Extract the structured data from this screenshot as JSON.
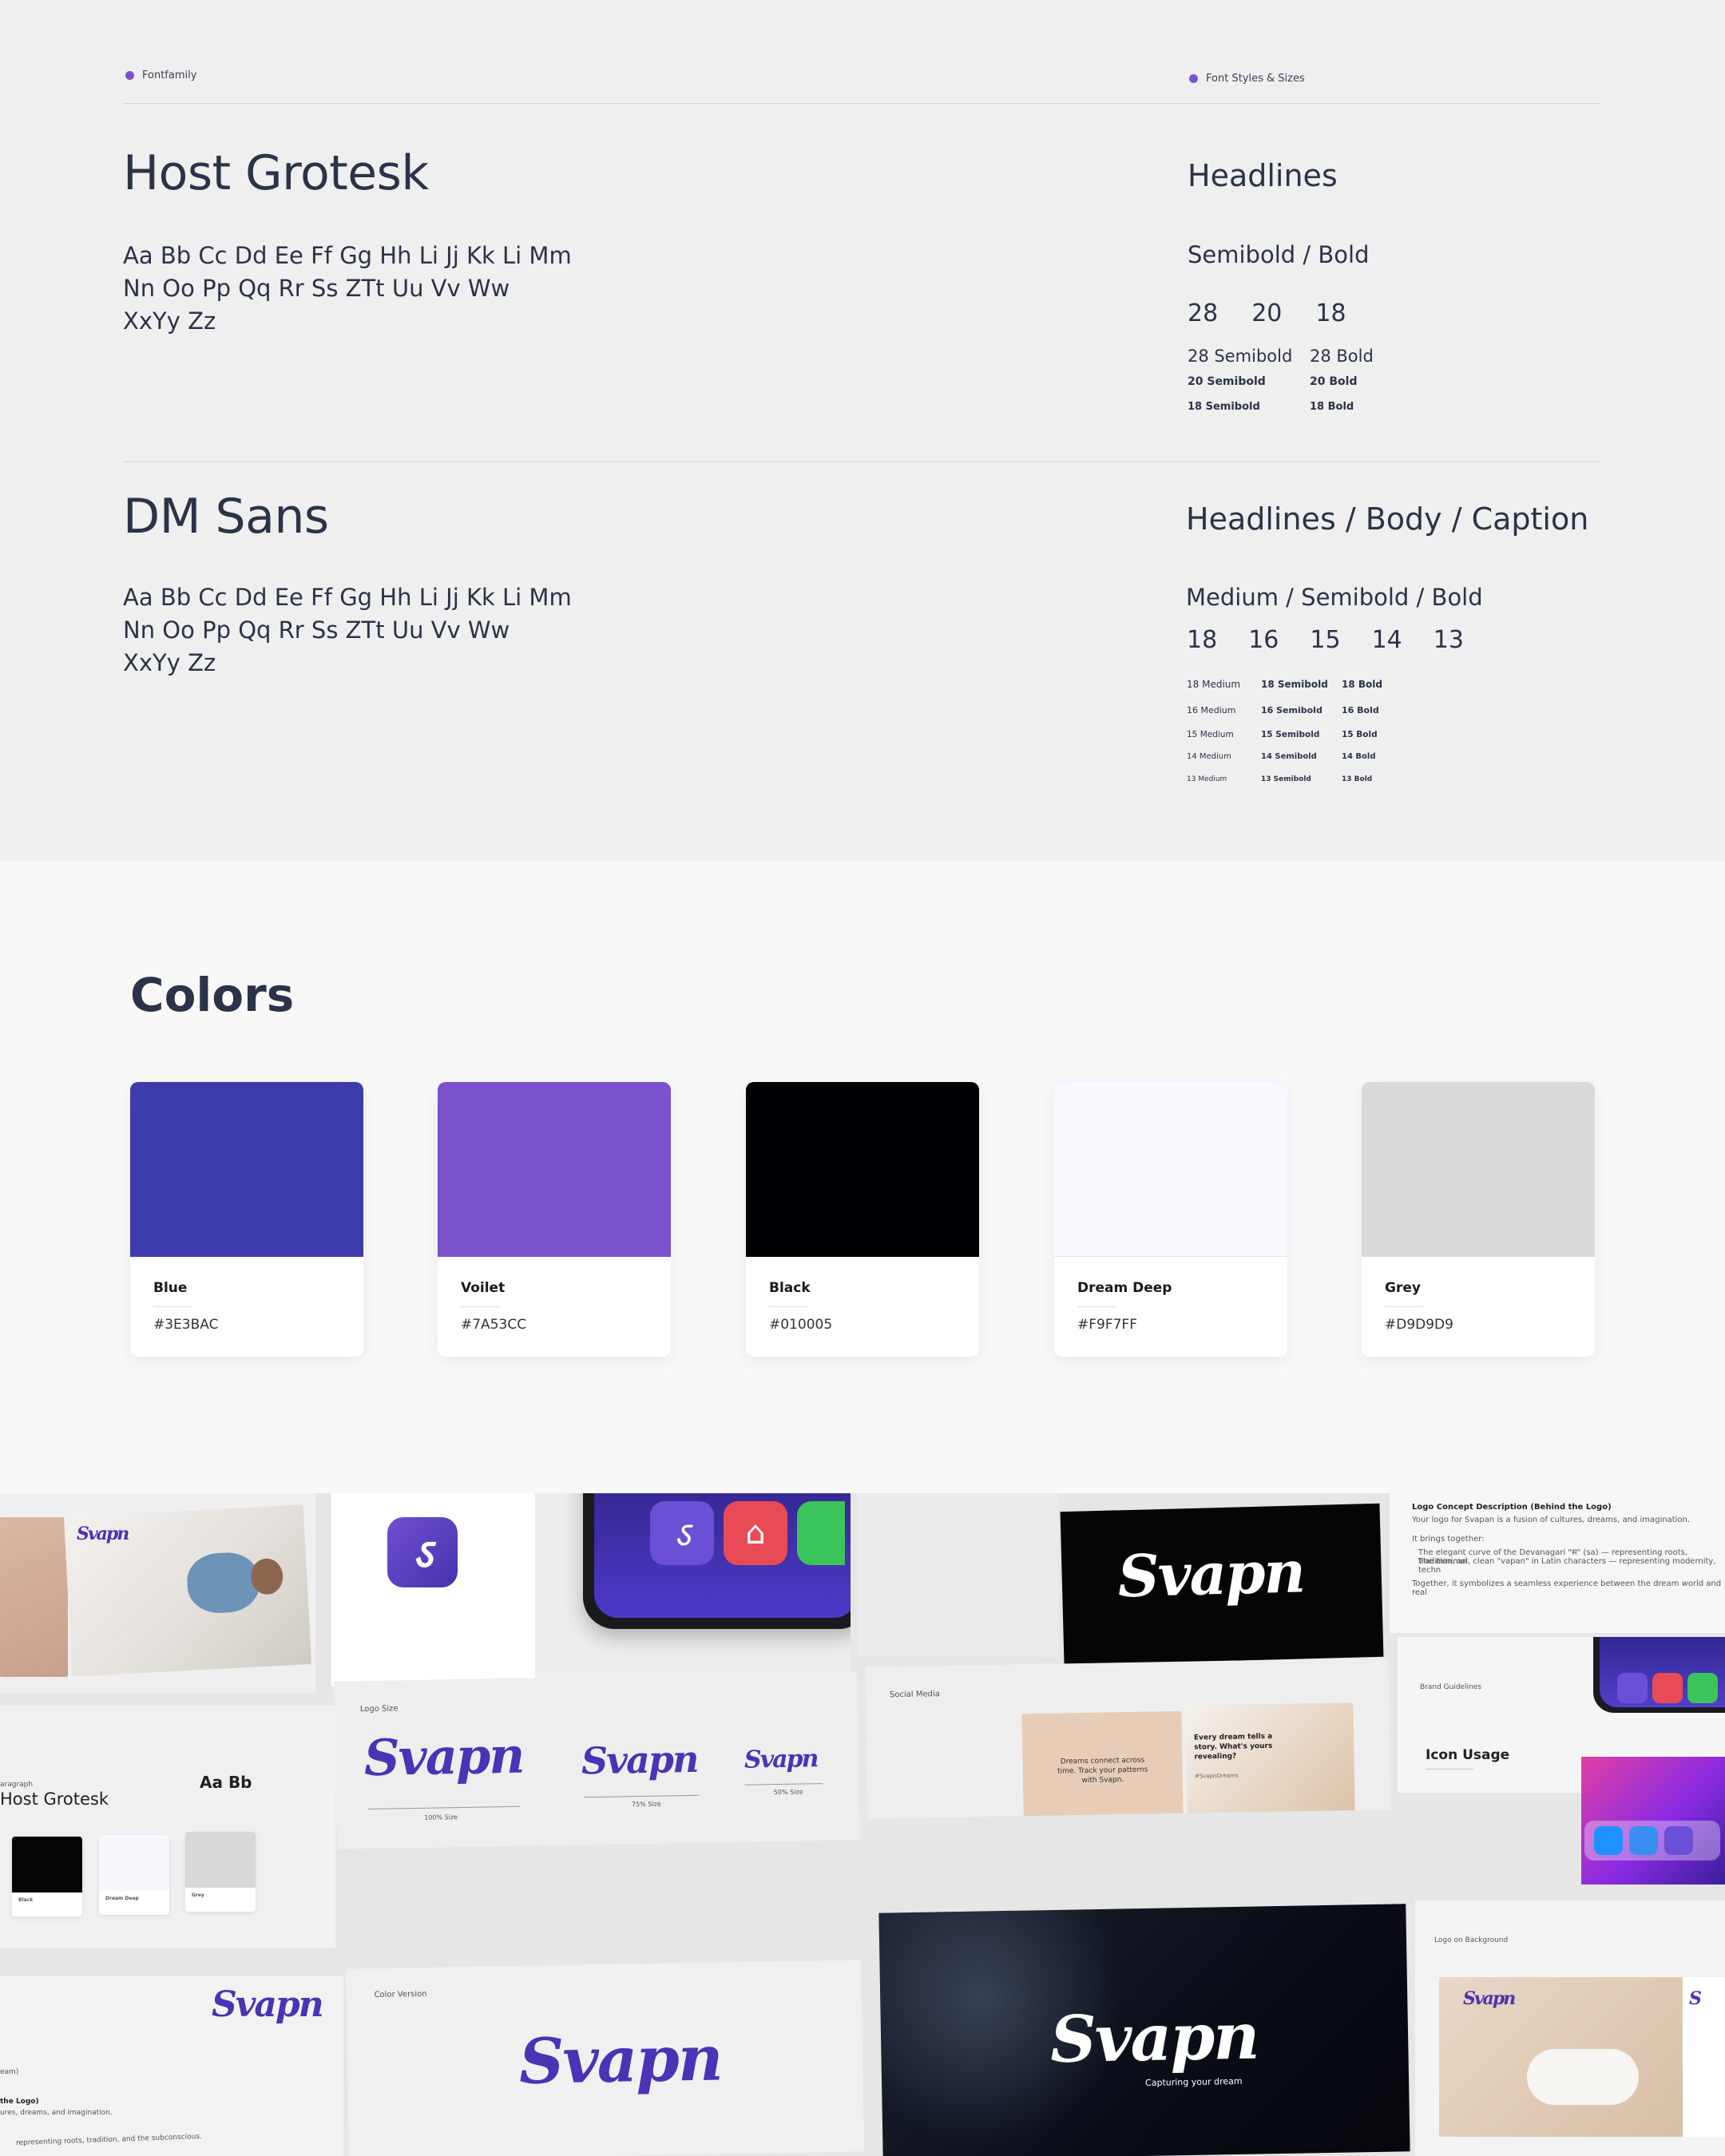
{
  "typography": {
    "tag_left": "Fontfamily",
    "tag_right": "Font Styles & Sizes",
    "host": {
      "name": "Host Grotesk",
      "alphabet": [
        "Aa Bb Cc Dd Ee Ff Gg Hh Li Jj Kk Li Mm",
        "Nn Oo Pp Qq Rr Ss ZTt Uu Vv Ww",
        "XxYy Zz"
      ],
      "title": "Headlines",
      "weights": "Semibold / Bold",
      "sizes": [
        "28",
        "20",
        "18"
      ],
      "table": [
        [
          "28 Semibold",
          "28 Bold"
        ],
        [
          "20 Semibold",
          "20 Bold"
        ],
        [
          "18 Semibold",
          "18 Bold"
        ]
      ]
    },
    "dm": {
      "name": "DM Sans",
      "alphabet": [
        "Aa Bb Cc Dd Ee Ff Gg Hh Li Jj Kk Li Mm",
        "Nn Oo Pp Qq Rr Ss ZTt Uu Vv Ww",
        "XxYy Zz"
      ],
      "title": "Headlines / Body / Caption",
      "weights": "Medium / Semibold / Bold",
      "sizes": [
        "18",
        "16",
        "15",
        "14",
        "13"
      ],
      "table": [
        [
          "18 Medium",
          "18 Semibold",
          "18 Bold"
        ],
        [
          "16 Medium",
          "16 Semibold",
          "16 Bold"
        ],
        [
          "15 Medium",
          "15 Semibold",
          "15 Bold"
        ],
        [
          "14 Medium",
          "14 Semibold",
          "14 Bold"
        ],
        [
          "13 Medium",
          "13 Semibold",
          "13 Bold"
        ]
      ]
    }
  },
  "colors": {
    "title": "Colors",
    "swatches": [
      {
        "name": "Blue",
        "hex": "#3E3BAC",
        "color": "#3E3BAC"
      },
      {
        "name": "Voilet",
        "hex": "#7A53CC",
        "color": "#7A53CC"
      },
      {
        "name": "Black",
        "hex": "#010005",
        "color": "#010005"
      },
      {
        "name": "Dream Deep",
        "hex": "#F9F7FF",
        "color": "#F9F7FF"
      },
      {
        "name": "Grey",
        "hex": "#D9D9D9",
        "color": "#D9D9D9"
      }
    ]
  },
  "collage": {
    "brand": "Svapn",
    "logo_word": "vapn",
    "tagline": "Capturing your dream",
    "labels": {
      "logo_size": "Logo Size",
      "size_100": "100% Size",
      "size_75": "75% Size",
      "size_50": "50% Size",
      "social": "Social Media",
      "brand_guidelines": "Brand Guidelines",
      "icon_usage": "Icon Usage",
      "color_version": "Color Version",
      "logo_on_background": "Logo on Background",
      "logo_concept": "Logo Concept Description (Behind the Logo)",
      "concept_line1": "Your logo for Svapan is a fusion of cultures, dreams, and imagination.",
      "concept_line2": "It brings together:",
      "concept_line3": "The elegant curve of the Devanagari \"स\" (sa) — representing roots, tradition, an",
      "concept_line4": "The minimal, clean \"vapan\" in Latin characters — representing modernity, techn",
      "concept_line5": "Together, it symbolizes a seamless experience between the dream world and real",
      "paragraph": "aragraph",
      "host_grotesk": "Host Grotesk",
      "aa_bb": "Aa Bb",
      "mini_black": "Black",
      "mini_dream": "Dream Deep",
      "mini_grey": "Grey",
      "social_card1": "Dreams connect across time. Track your patterns with Svapn.",
      "social_card2": "Every dream tells a story. What's yours revealing?",
      "hashtag": "#SvapnDreams",
      "frag1": "the Logo)",
      "frag2": "ures, dreams, and imagination.",
      "frag3": "representing roots, tradition, and the subconscious.",
      "frag4": "eam)"
    }
  }
}
